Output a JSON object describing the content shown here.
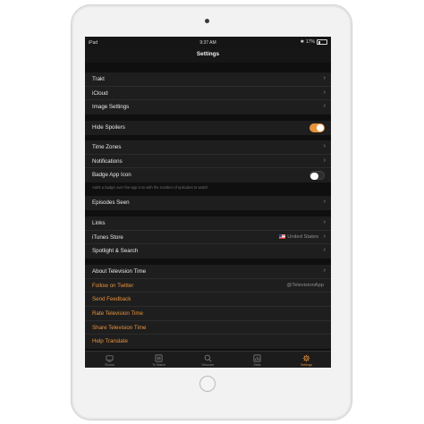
{
  "status_bar": {
    "device": "iPad",
    "time": "9:37 AM",
    "battery": "17%"
  },
  "nav": {
    "title": "Settings"
  },
  "groups": {
    "g1": [
      "Trakt",
      "iCloud",
      "Image Settings"
    ],
    "g2": {
      "hide_spoilers": "Hide Spoilers",
      "hide_spoilers_on": true
    },
    "g3": {
      "time_zones": "Time Zones",
      "notifications": "Notifications",
      "badge_app_icon": "Badge App Icon",
      "badge_on": false,
      "footnote": "Adds a badge over the app icon with the number of episodes to watch"
    },
    "g4": [
      "Episodes Seen"
    ],
    "g5": {
      "links": "Links",
      "itunes_store": "iTunes Store",
      "itunes_value": "United States",
      "spotlight": "Spotlight & Search"
    },
    "g6": {
      "about": "About Television Time",
      "follow": "Follow on Twitter",
      "follow_value": "@TelevisionApp",
      "feedback": "Send Feedback",
      "rate": "Rate Television Time",
      "share": "Share Television Time",
      "translate": "Help Translate"
    }
  },
  "tabs": [
    {
      "label": "Shows",
      "icon": "tv-icon"
    },
    {
      "label": "To Watch",
      "icon": "list-icon"
    },
    {
      "label": "Discover",
      "icon": "search-icon"
    },
    {
      "label": "Stats",
      "icon": "stats-icon"
    },
    {
      "label": "Settings",
      "icon": "gear-icon",
      "active": true
    }
  ],
  "colors": {
    "accent": "#e8923c",
    "background": "#151515",
    "cell": "#1e1e1e"
  }
}
